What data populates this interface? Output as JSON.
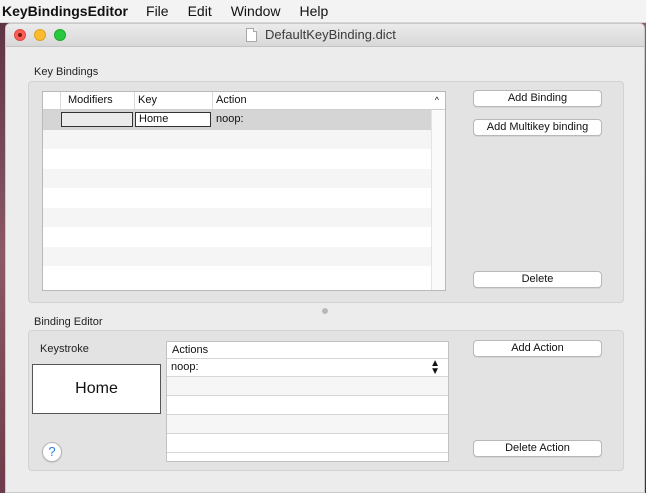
{
  "menubar": {
    "app_name": "KeyBindingsEditor",
    "items": [
      "File",
      "Edit",
      "Window",
      "Help"
    ]
  },
  "window": {
    "title": "DefaultKeyBinding.dict"
  },
  "key_bindings": {
    "section_label": "Key Bindings",
    "columns": [
      "Modifiers",
      "Key",
      "Action"
    ],
    "rows": [
      {
        "modifiers": "",
        "key": "Home",
        "action": "noop:"
      }
    ],
    "buttons": {
      "add_binding": "Add Binding",
      "add_multikey": "Add Multikey binding",
      "delete": "Delete"
    }
  },
  "binding_editor": {
    "section_label": "Binding Editor",
    "keystroke_label": "Keystroke",
    "keystroke_value": "Home",
    "actions_header": "Actions",
    "actions": [
      "noop:"
    ],
    "buttons": {
      "add_action": "Add Action",
      "delete_action": "Delete Action"
    },
    "help_label": "?"
  },
  "icons": {
    "sort": "sort-ascending-icon",
    "popup": "up-down-chevron-icon",
    "doc": "document-icon"
  },
  "colors": {
    "close": "#fc5f57",
    "minimize": "#fdbc2e",
    "zoom": "#28c840",
    "help_accent": "#2a7de1"
  }
}
